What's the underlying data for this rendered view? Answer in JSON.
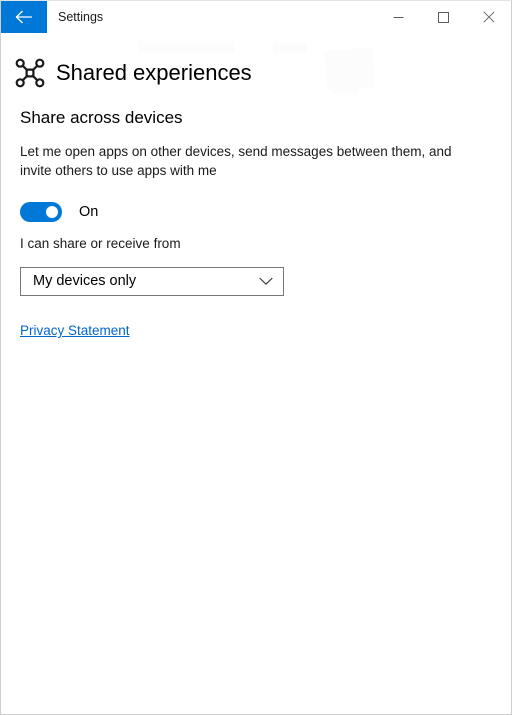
{
  "window": {
    "title": "Settings",
    "back_icon": "back-arrow-icon",
    "controls": {
      "minimize": "minimize-icon",
      "maximize": "maximize-icon",
      "close": "close-icon"
    }
  },
  "header": {
    "icon": "shared-experiences-hub-icon",
    "title": "Shared experiences"
  },
  "main": {
    "section_heading": "Share across devices",
    "section_description": "Let me open apps on other devices, send messages between them, and invite others to use apps with me",
    "toggle": {
      "state_label": "On",
      "checked": true
    },
    "dropdown_label": "I can share or receive from",
    "dropdown": {
      "value": "My devices only",
      "chevron_icon": "chevron-down-icon"
    },
    "privacy_link": "Privacy Statement"
  },
  "colors": {
    "accent": "#0078d7",
    "link": "#0066cc",
    "text": "#000000",
    "border": "#767676",
    "window_border": "#cfcfcf"
  }
}
